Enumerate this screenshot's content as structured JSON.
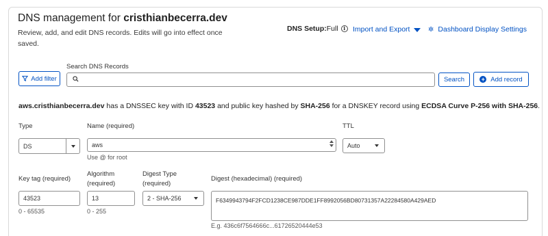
{
  "header": {
    "title_prefix": "DNS management for ",
    "title_domain": "cristhianbecerra.dev",
    "subtitle": "Review, add, and edit DNS records. Edits will go into effect once saved.",
    "setup_label": "DNS Setup:",
    "setup_value": "Full",
    "import_export_label": "Import and Export",
    "dashboard_settings_label": "Dashboard Display Settings"
  },
  "toolbar": {
    "add_filter_label": "Add filter",
    "search_label": "Search DNS Records",
    "search_value": "",
    "search_placeholder": "",
    "search_button_label": "Search",
    "add_record_label": "Add record"
  },
  "dnssec": {
    "zone": "aws.cristhianbecerra.dev",
    "text1": " has a DNSSEC key with ID ",
    "key_id": "43523",
    "text2": " and public key hashed by ",
    "hash": "SHA-256",
    "text3": " for a DNSKEY record using ",
    "algo": "ECDSA Curve P-256 with SHA-256",
    "text4": "."
  },
  "form": {
    "type_label": "Type",
    "type_value": "DS",
    "name_label": "Name (required)",
    "name_value": "aws",
    "name_hint": "Use @ for root",
    "ttl_label": "TTL",
    "ttl_value": "Auto",
    "key_tag_label": "Key tag (required)",
    "key_tag_value": "43523",
    "key_tag_hint": "0 - 65535",
    "algorithm_label_1": "Algorithm",
    "algorithm_label_2": "(required)",
    "algorithm_value": "13",
    "algorithm_hint": "0 - 255",
    "digest_type_label_1": "Digest Type",
    "digest_type_label_2": "(required)",
    "digest_type_value": "2 - SHA-256",
    "digest_label": "Digest (hexadecimal) (required)",
    "digest_value": "F6349943794F2FCD1238CE987DDE1FF8992056BD80731357A22284580A429AED",
    "digest_hint": "E.g. 436c6f7564666c...61726520444e53"
  },
  "icons": {
    "info": "info-icon",
    "caret": "caret-down-icon",
    "gear": "gear-icon",
    "filter": "filter-icon",
    "search": "search-icon",
    "plus": "plus-circle-icon"
  },
  "colors": {
    "accent": "#0051c3",
    "border": "#8f8f8f"
  }
}
